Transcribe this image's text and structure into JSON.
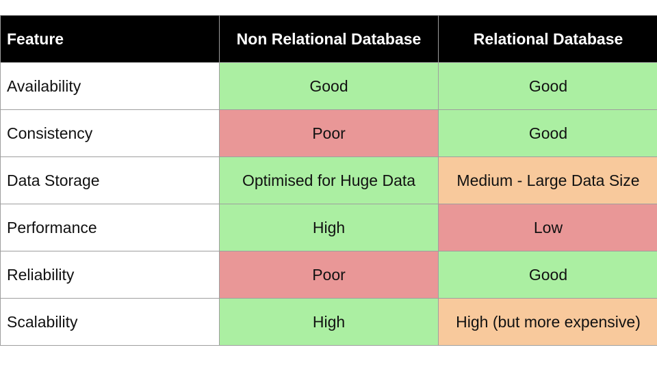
{
  "headers": [
    "Feature",
    "Non Relational Database",
    "Relational Database"
  ],
  "colors": {
    "good": "#abefa2",
    "poor": "#e99797",
    "medium": "#f8c99c",
    "header_bg": "#000000"
  },
  "rows": [
    {
      "feature": "Availability",
      "non_relational": "Good",
      "non_relational_rating": "good",
      "relational": "Good",
      "relational_rating": "good"
    },
    {
      "feature": "Consistency",
      "non_relational": "Poor",
      "non_relational_rating": "poor",
      "relational": "Good",
      "relational_rating": "good"
    },
    {
      "feature": "Data Storage",
      "non_relational": "Optimised for Huge Data",
      "non_relational_rating": "good",
      "relational": "Medium - Large Data Size",
      "relational_rating": "medium"
    },
    {
      "feature": "Performance",
      "non_relational": "High",
      "non_relational_rating": "good",
      "relational": "Low",
      "relational_rating": "poor"
    },
    {
      "feature": "Reliability",
      "non_relational": "Poor",
      "non_relational_rating": "poor",
      "relational": "Good",
      "relational_rating": "good"
    },
    {
      "feature": "Scalability",
      "non_relational": "High",
      "non_relational_rating": "good",
      "relational": "High (but more expensive)",
      "relational_rating": "medium"
    }
  ]
}
